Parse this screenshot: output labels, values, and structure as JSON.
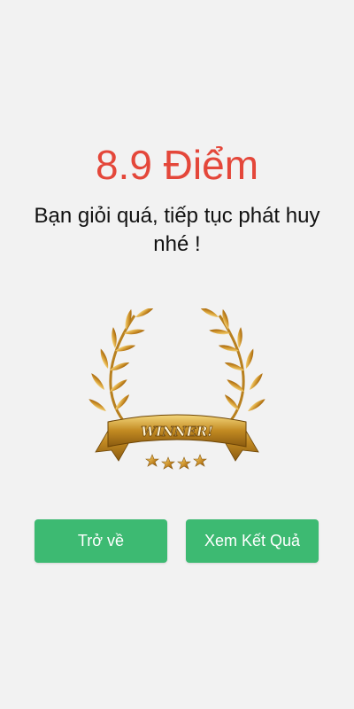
{
  "result": {
    "score_text": "8.9 Điểm",
    "message": "Bạn giỏi quá, tiếp tục phát huy nhé !"
  },
  "badge": {
    "text": "WINNER!",
    "icon": "winner-laurel-icon",
    "stars": 4
  },
  "actions": {
    "back_label": "Trở về",
    "view_result_label": "Xem Kết Quả"
  },
  "colors": {
    "background": "#f2f2f2",
    "score": "#e4473a",
    "button": "#3dba72",
    "gold": "#c8901e"
  }
}
